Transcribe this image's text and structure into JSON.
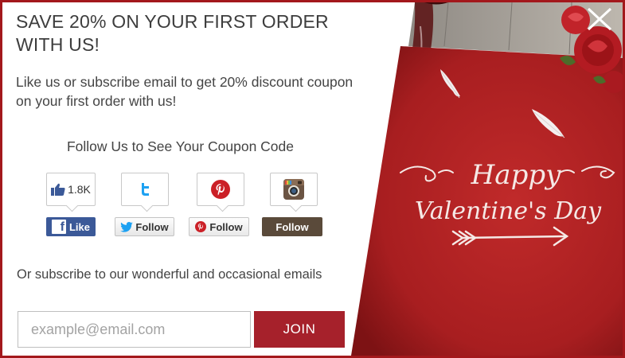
{
  "popup": {
    "headline": "SAVE 20% ON YOUR FIRST ORDER WITH US!",
    "subtext": "Like us or subscribe email to get 20% discount coupon on your first order with us!",
    "follow_title": "Follow Us to See Your Coupon Code",
    "subscribe_text": "Or subscribe to our wonderful and occasional emails"
  },
  "social": {
    "facebook": {
      "count": "1.8K",
      "button_label": "Like",
      "logo_letter": "f"
    },
    "twitter": {
      "button_label": "Follow"
    },
    "pinterest": {
      "button_label": "Follow"
    },
    "instagram": {
      "button_label": "Follow"
    }
  },
  "form": {
    "email_placeholder": "example@email.com",
    "join_label": "JOIN"
  },
  "banner": {
    "line1": "Happy",
    "line2": "Valentine's Day"
  },
  "colors": {
    "accent": "#a6212b",
    "border": "#a3181c",
    "facebook": "#3b5998",
    "twitter": "#1da1f2",
    "pinterest": "#cb2027",
    "instagram_button": "#5a4a3a"
  }
}
